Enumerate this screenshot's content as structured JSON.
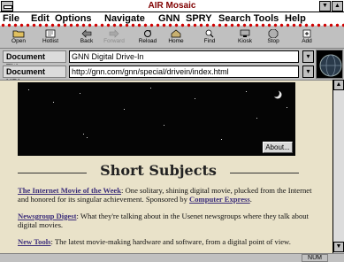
{
  "window": {
    "title": "AIR Mosaic"
  },
  "menu": [
    {
      "label": "File"
    },
    {
      "label": "Edit"
    },
    {
      "label": "Options"
    },
    {
      "label": "Navigate"
    },
    {
      "label": "GNN"
    },
    {
      "label": "SPRY"
    },
    {
      "label": "Search Tools"
    },
    {
      "label": "Help"
    }
  ],
  "toolbar": [
    {
      "label": "Open",
      "icon": "folder-icon",
      "enabled": true
    },
    {
      "label": "Hotlist",
      "icon": "hotlist-icon",
      "enabled": true
    },
    {
      "label": "Back",
      "icon": "back-arrow-icon",
      "enabled": true
    },
    {
      "label": "Forward",
      "icon": "forward-arrow-icon",
      "enabled": false
    },
    {
      "label": "Reload",
      "icon": "reload-icon",
      "enabled": true
    },
    {
      "label": "Home",
      "icon": "home-icon",
      "enabled": true
    },
    {
      "label": "Find",
      "icon": "find-icon",
      "enabled": true
    },
    {
      "label": "Kiosk",
      "icon": "kiosk-icon",
      "enabled": true
    },
    {
      "label": "Stop",
      "icon": "stop-icon",
      "enabled": true
    },
    {
      "label": "Add",
      "icon": "add-icon",
      "enabled": true
    }
  ],
  "fields": {
    "doc_title_label": "Document Title:",
    "doc_title_value": "GNN Digital Drive-In",
    "doc_url_label": "Document URL:",
    "doc_url_value": "http://gnn.com/gnn/special/drivein/index.html"
  },
  "page": {
    "about_label": "About...",
    "heading": "Short Subjects",
    "items": [
      {
        "link": "The Internet Movie of the Week",
        "text": ": One solitary, shining digital movie, plucked from the Internet and honored for its singular achievement. Sponsored by ",
        "link2": "Computer Express",
        "tail": "."
      },
      {
        "link": "Newsgroup Digest",
        "text": ": What they're talking about in the Usenet newsgroups where they talk about digital movies.",
        "link2": "",
        "tail": ""
      },
      {
        "link": "New Tools",
        "text": ": The latest movie-making hardware and software, from a digital point of view.",
        "link2": "",
        "tail": ""
      }
    ]
  },
  "status": {
    "indicator": "NUM"
  },
  "colors": {
    "menu_accent": "#d00000",
    "title_text": "#800000",
    "page_bg": "#e9e2c9",
    "link": "#3b2d7a"
  }
}
